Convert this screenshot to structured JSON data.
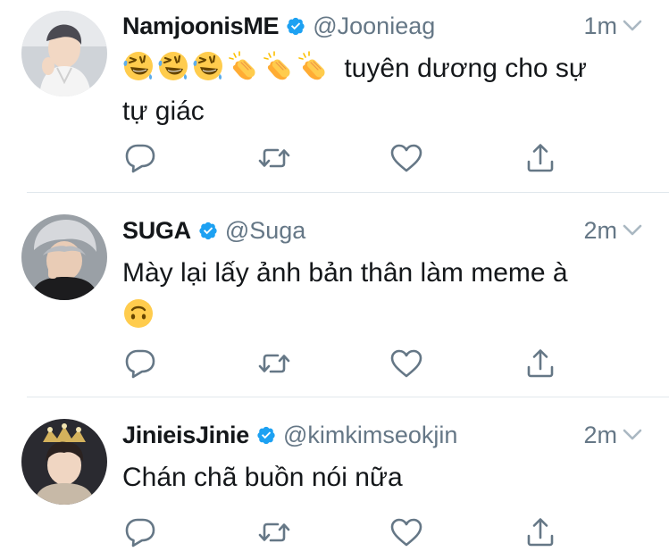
{
  "colors": {
    "verified": "#1da1f2",
    "secondary_text": "#657786",
    "primary_text": "#14171a",
    "icon": "#657786",
    "divider": "#e1e8ed"
  },
  "tweets": [
    {
      "name": "NamjoonisME",
      "handle": "@Joonieag",
      "time": "1m",
      "text_line1": "tuyên dương cho sự",
      "text_line2": "tự giác",
      "emojis": [
        "rolling-on-floor-laughing",
        "rolling-on-floor-laughing",
        "rolling-on-floor-laughing",
        "clapping-hands",
        "clapping-hands",
        "clapping-hands"
      ]
    },
    {
      "name": "SUGA",
      "handle": "@Suga",
      "time": "2m",
      "text_line1": "Mày lại lấy ảnh bản thân làm meme à",
      "emojis": [
        "upside-down-face"
      ]
    },
    {
      "name": "JinieisJinie",
      "handle": "@kimkimseokjin",
      "time": "2m",
      "text_line1": "Chán chã buồn nói nữa"
    }
  ],
  "actions": [
    "reply-icon",
    "retweet-icon",
    "like-icon",
    "share-icon"
  ]
}
